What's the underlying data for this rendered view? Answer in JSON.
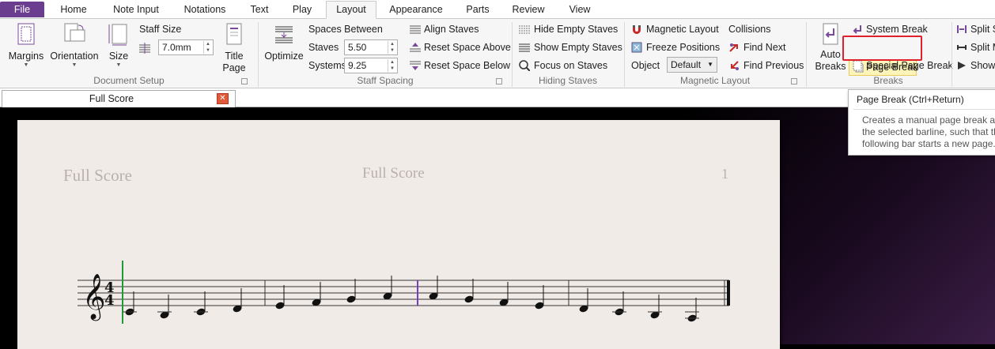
{
  "tabs": [
    "File",
    "Home",
    "Note Input",
    "Notations",
    "Text",
    "Play",
    "Layout",
    "Appearance",
    "Parts",
    "Review",
    "View"
  ],
  "active_tab": "Layout",
  "document_setup": {
    "margins": "Margins",
    "orientation": "Orientation",
    "size": "Size",
    "staff_size_label": "Staff Size",
    "staff_size_value": "7.0mm",
    "title_page_line1": "Title",
    "title_page_line2": "Page",
    "group_label": "Document Setup"
  },
  "staff_spacing": {
    "optimize": "Optimize",
    "spaces_between": "Spaces Between",
    "staves_label": "Staves",
    "staves_value": "5.50",
    "systems_label": "Systems",
    "systems_value": "9.25",
    "align_staves": "Align Staves",
    "reset_above": "Reset Space Above",
    "reset_below": "Reset Space Below",
    "group_label": "Staff Spacing"
  },
  "hiding_staves": {
    "hide_empty": "Hide Empty Staves",
    "show_empty": "Show Empty Staves",
    "focus": "Focus on Staves",
    "group_label": "Hiding Staves"
  },
  "magnetic_layout": {
    "magnetic": "Magnetic Layout",
    "freeze": "Freeze Positions",
    "object_label": "Object",
    "object_value": "Default",
    "collisions": "Collisions",
    "find_next": "Find Next",
    "find_previous": "Find Previous",
    "group_label": "Magnetic Layout"
  },
  "breaks": {
    "auto_line1": "Auto",
    "auto_line2": "Breaks",
    "system_break": "System Break",
    "page_break": "Page Break",
    "special_page_break": "Special Page Break",
    "split_s": "Split S",
    "split_m": "Split M",
    "show": "Show",
    "group_label": "Breaks"
  },
  "document_tab": "Full Score",
  "score": {
    "part_name": "Full Score",
    "title": "Full Score",
    "page_number": "1",
    "time_sig_top": "4",
    "time_sig_bottom": "4"
  },
  "tooltip": {
    "title": "Page Break (Ctrl+Return)",
    "line1": "Creates a manual page break at",
    "line2": "the selected barline, such that th",
    "line3": "following bar starts a new page."
  },
  "colors": {
    "file_tab": "#6b3d8f",
    "highlight": "#e0202a",
    "page_break_bg": "#fcf4b8"
  }
}
